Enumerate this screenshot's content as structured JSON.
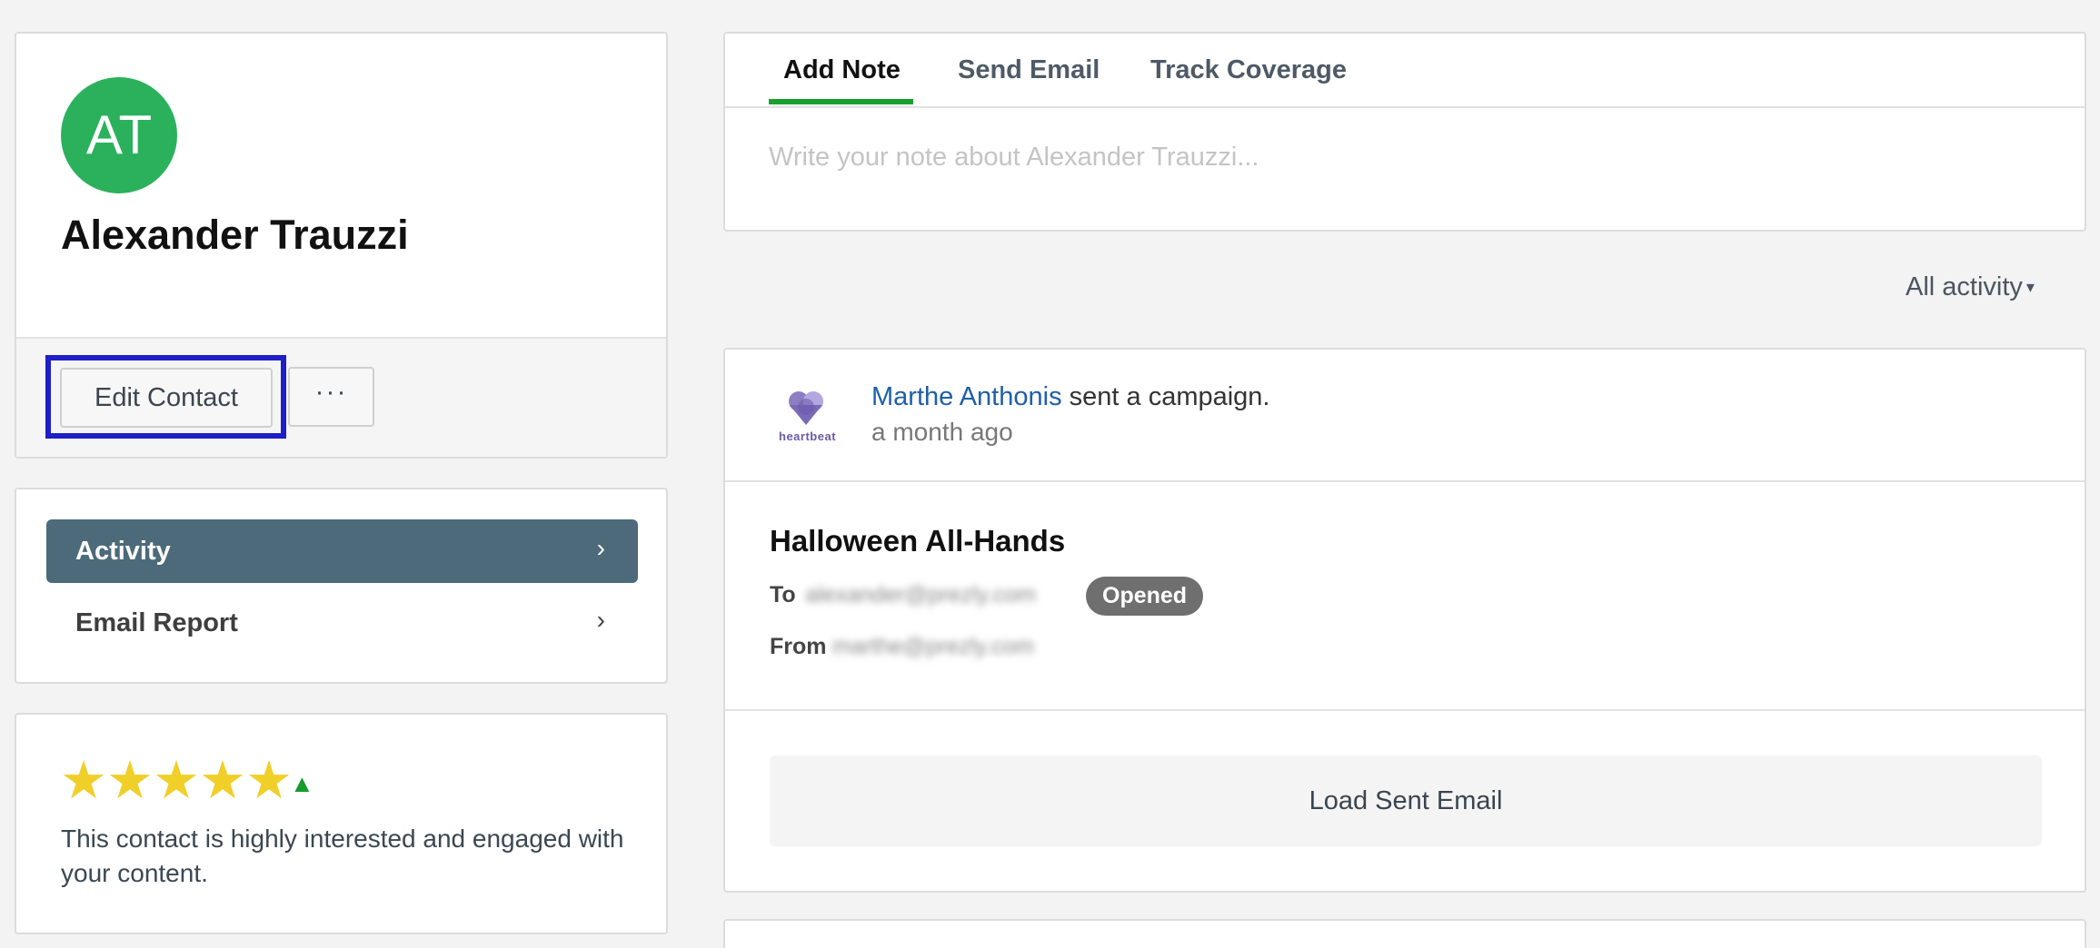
{
  "contact": {
    "initials": "AT",
    "name": "Alexander Trauzzi",
    "edit_label": "Edit Contact",
    "more_label": "···",
    "avatar_color": "#2bb15c"
  },
  "nav": {
    "items": [
      {
        "label": "Activity",
        "chevron": "›"
      },
      {
        "label": "Email Report",
        "chevron": "›"
      }
    ]
  },
  "score": {
    "stars_text": "★★★★★",
    "rating": 5,
    "max": 5,
    "trend_icon": "▲",
    "description": "This contact is highly interested and engaged with your content."
  },
  "composer": {
    "tabs": [
      {
        "label": "Add Note"
      },
      {
        "label": "Send Email"
      },
      {
        "label": "Track Coverage"
      }
    ],
    "placeholder": "Write your note about Alexander Trauzzi..."
  },
  "filter": {
    "label": "All activity",
    "caret": "▾"
  },
  "activity": {
    "logo_text": "heartbeat",
    "actor": "Marthe Anthonis",
    "action": " sent a campaign.",
    "time": "a month ago",
    "email_title": "Halloween All-Hands",
    "to_label": "To",
    "to_value": "alexander@prezly.com",
    "from_label": "From",
    "from_value": "marthe@prezly.com",
    "status_badge": "Opened",
    "load_label": "Load Sent Email"
  },
  "colors": {
    "accent_green": "#17a02e",
    "nav_active": "#4c6a7a",
    "link_blue": "#1d5fa8",
    "star_yellow": "#f1cf29",
    "highlight_blue": "#1f1fc8"
  }
}
